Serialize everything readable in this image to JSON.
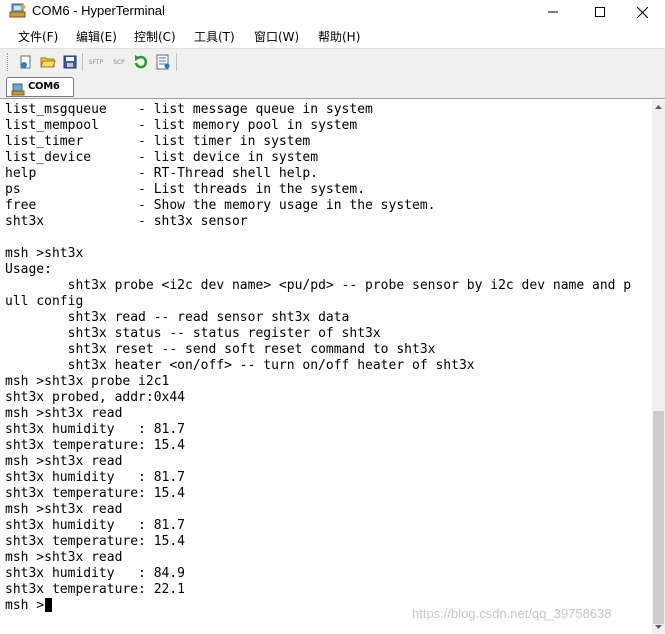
{
  "window": {
    "title": "COM6 - HyperTerminal"
  },
  "menu": [
    "文件(F)",
    "编辑(E)",
    "控制(C)",
    "工具(T)",
    "窗口(W)",
    "帮助(H)"
  ],
  "toolbar": {
    "sftp_label": "SFTP",
    "scp_label": "SCP"
  },
  "tab": {
    "label": "COM6"
  },
  "terminal": {
    "lines": [
      "list_msgqueue    - list message queue in system",
      "list_mempool     - list memory pool in system",
      "list_timer       - list timer in system",
      "list_device      - list device in system",
      "help             - RT-Thread shell help.",
      "ps               - List threads in the system.",
      "free             - Show the memory usage in the system.",
      "sht3x            - sht3x sensor",
      "",
      "msh >sht3x",
      "Usage:",
      "        sht3x probe <i2c dev name> <pu/pd> -- probe sensor by i2c dev name and p",
      "ull config",
      "        sht3x read -- read sensor sht3x data",
      "        sht3x status -- status register of sht3x",
      "        sht3x reset -- send soft reset command to sht3x",
      "        sht3x heater <on/off> -- turn on/off heater of sht3x",
      "msh >sht3x probe i2c1",
      "sht3x probed, addr:0x44",
      "msh >sht3x read",
      "sht3x humidity   : 81.7",
      "sht3x temperature: 15.4",
      "msh >sht3x read",
      "sht3x humidity   : 81.7",
      "sht3x temperature: 15.4",
      "msh >sht3x read",
      "sht3x humidity   : 81.7",
      "sht3x temperature: 15.4",
      "msh >sht3x read",
      "sht3x humidity   : 84.9",
      "sht3x temperature: 22.1",
      "msh >"
    ]
  },
  "watermark": "https://blog.csdn.net/qq_39758638",
  "icons": {
    "app": "hyperterminal-app-icon",
    "minimize": "minimize-icon",
    "maximize": "maximize-icon",
    "close": "close-icon",
    "toolbar": [
      "new-connection-icon",
      "open-folder-icon",
      "save-icon",
      "sftp-icon",
      "scp-icon",
      "reconnect-icon",
      "properties-icon"
    ]
  }
}
